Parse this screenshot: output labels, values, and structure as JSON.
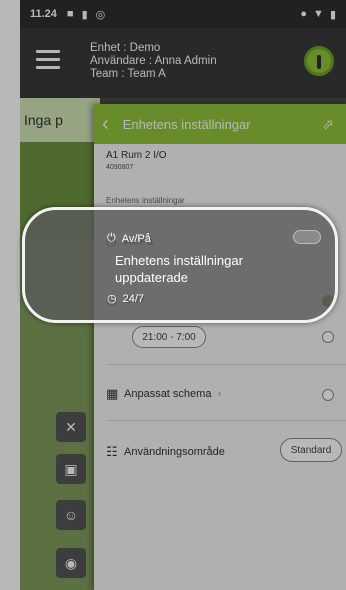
{
  "status_bar": {
    "time": "11.24"
  },
  "header": {
    "device_line": "Enhet : Demo",
    "user_line": "Användare : Anna Admin",
    "team_line": "Team : Team A"
  },
  "background": {
    "partial_text": "Inga p"
  },
  "panel": {
    "title": "Enhetens inställningar",
    "device_name": "A1 Rum 2 I/O",
    "device_id": "4090807",
    "section_title": "Enhetens inställningar",
    "power_label": "Av/På",
    "schedule_24_label": "24/7",
    "time_range": "21:00 - 7:00",
    "custom_schedule_label": "Anpassat schema",
    "usage_label": "Användningsområde",
    "usage_value": "Standard"
  },
  "toast": {
    "line1": "Enhetens inställningar",
    "line2": "uppdaterade"
  },
  "colors": {
    "accent_green": "#8fc33a",
    "radio_selected": "#6c9a2e",
    "appbar": "#3a3a3a"
  },
  "icons": {
    "menu": "menu-icon",
    "logo": "brand-logo",
    "back": "chevron-left-icon",
    "share": "share-icon",
    "power": "power-icon",
    "clock": "clock-icon",
    "calendar": "calendar-icon",
    "usage": "list-icon"
  }
}
